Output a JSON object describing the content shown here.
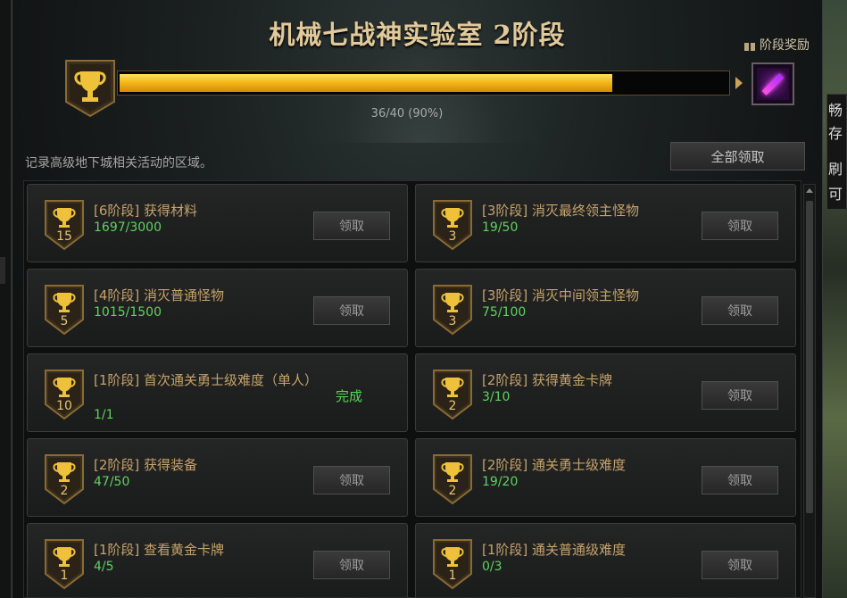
{
  "window": {
    "title": "机械七战神实验室 2阶段",
    "stage_reward_label": "阶段奖励",
    "progress": {
      "text": "36/40 (90%)",
      "current": 36,
      "total": 40,
      "fraction": 0.9
    },
    "description": "记录高级地下城相关活动的区域。",
    "claim_all_label": "全部领取"
  },
  "tasks": [
    {
      "name": "[6阶段] 获得材料",
      "count": "1697/3000",
      "badge": "15",
      "status": "claim",
      "button": "领取"
    },
    {
      "name": "[3阶段] 消灭最终领主怪物",
      "count": "19/50",
      "badge": "3",
      "status": "claim",
      "button": "领取"
    },
    {
      "name": "[4阶段] 消灭普通怪物",
      "count": "1015/1500",
      "badge": "5",
      "status": "claim",
      "button": "领取"
    },
    {
      "name": "[3阶段] 消灭中间领主怪物",
      "count": "75/100",
      "badge": "3",
      "status": "claim",
      "button": "领取"
    },
    {
      "name": "[1阶段] 首次通关勇士级难度（单人）",
      "count": "1/1",
      "badge": "10",
      "status": "done",
      "done_label": "完成"
    },
    {
      "name": "[2阶段] 获得黄金卡牌",
      "count": "3/10",
      "badge": "2",
      "status": "claim",
      "button": "领取"
    },
    {
      "name": "[2阶段] 获得装备",
      "count": "47/50",
      "badge": "2",
      "status": "claim",
      "button": "领取"
    },
    {
      "name": "[2阶段] 通关勇士级难度",
      "count": "19/20",
      "badge": "2",
      "status": "claim",
      "button": "领取"
    },
    {
      "name": "[1阶段] 查看黄金卡牌",
      "count": "4/5",
      "badge": "1",
      "status": "claim",
      "button": "领取"
    },
    {
      "name": "[1阶段] 通关普通级难度",
      "count": "0/3",
      "badge": "1",
      "status": "claim",
      "button": "领取"
    }
  ],
  "background": {
    "right_chars": [
      "畅",
      "存",
      "刷",
      "可"
    ]
  },
  "colors": {
    "title": "#e2c99a",
    "task_name": "#c6a36a",
    "task_count": "#5fd35f",
    "progress_fill": "#f6b81a"
  },
  "icons": {
    "trophy": "trophy-icon",
    "gift": "gift-icon",
    "reward_item": "reward-item-icon"
  }
}
